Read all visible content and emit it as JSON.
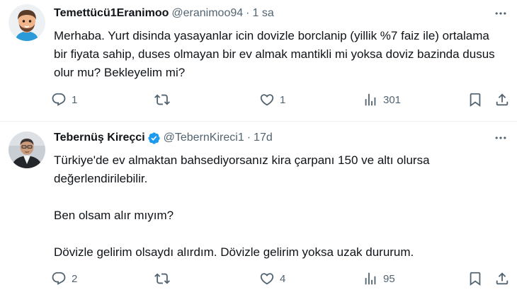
{
  "tweets": [
    {
      "display_name": "Temettücü1Eranimoo",
      "handle": "@eranimoo94",
      "separator": "·",
      "time": "1 sa",
      "verified": false,
      "avatar_icon": "memoji-avatar",
      "text_paragraphs": [
        "Merhaba. Yurt disinda yasayanlar icin dovizle borclanip (yillik %7 faiz ile) ortalama bir fiyata sahip, duses olmayan bir ev almak mantikli mi yoksa doviz bazinda dusus olur mu? Bekleyelim mi?"
      ],
      "replies": "1",
      "retweets": "",
      "likes": "1",
      "views": "301"
    },
    {
      "display_name": "Tebernüş Kireçci",
      "handle": "@TebernKireci1",
      "separator": "·",
      "time": "17d",
      "verified": true,
      "avatar_icon": "profile-photo",
      "text_paragraphs": [
        "Türkiye'de ev almaktan bahsediyorsanız kira çarpanı 150 ve altı olursa değerlendirilebilir.",
        "Ben olsam alır mıyım?",
        "Dövizle gelirim olsaydı alırdım. Dövizle gelirim yoksa uzak dururum."
      ],
      "replies": "2",
      "retweets": "",
      "likes": "4",
      "views": "95"
    }
  ],
  "colors": {
    "text": "#0f1419",
    "muted": "#536471",
    "verified": "#1d9bf0",
    "divider": "#eff3f4"
  }
}
